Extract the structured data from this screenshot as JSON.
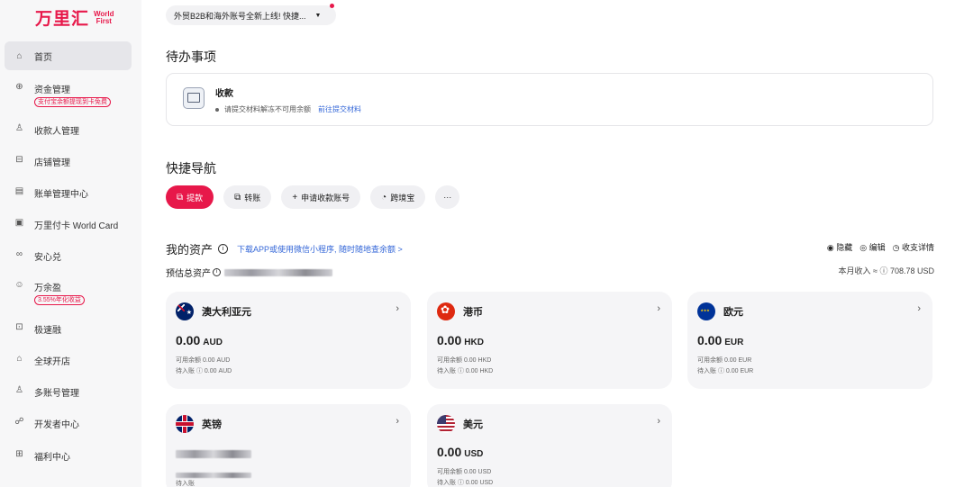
{
  "brand": {
    "logo_cn": "万里汇",
    "logo_en_line1": "World",
    "logo_en_line2": "First"
  },
  "sidebar": {
    "items": [
      {
        "label": "首页",
        "icon": "home-icon",
        "active": true
      },
      {
        "label": "资金管理",
        "icon": "fund-icon",
        "badge": "支付宝余额提现到卡免费"
      },
      {
        "label": "收款人管理",
        "icon": "payee-icon"
      },
      {
        "label": "店铺管理",
        "icon": "store-icon"
      },
      {
        "label": "账单管理中心",
        "icon": "bill-icon"
      },
      {
        "label": "万里付卡 World Card",
        "icon": "card-icon"
      },
      {
        "label": "安心兑",
        "icon": "exchange-icon"
      },
      {
        "label": "万余盈",
        "icon": "yield-icon",
        "badge": "3.55%年化收益"
      },
      {
        "label": "极速融",
        "icon": "finance-icon"
      },
      {
        "label": "全球开店",
        "icon": "global-store-icon"
      },
      {
        "label": "多账号管理",
        "icon": "multi-account-icon"
      },
      {
        "label": "开发者中心",
        "icon": "developer-icon"
      },
      {
        "label": "福利中心",
        "icon": "gift-icon"
      }
    ]
  },
  "announcement": {
    "text": "外贸B2B和海外账号全新上线! 快捷..."
  },
  "todo": {
    "section_title": "待办事项",
    "card_title": "收款",
    "desc": "请提交材料解冻不可用余额",
    "link": "前往提交材料"
  },
  "quick_nav": {
    "section_title": "快捷导航",
    "buttons": [
      {
        "label": "提款",
        "icon": "withdraw-icon",
        "primary": true
      },
      {
        "label": "转账",
        "icon": "transfer-icon"
      },
      {
        "label": "申请收款账号",
        "icon": "plus-icon"
      },
      {
        "label": "跨境宝",
        "icon": "crossborder-icon"
      },
      {
        "label": "···",
        "icon": "more-icon"
      }
    ]
  },
  "assets": {
    "title": "我的资产",
    "link": "下载APP或使用微信小程序, 随时随地查余额 >",
    "actions": {
      "hide": "隐藏",
      "edit": "编辑",
      "details": "收支详情"
    },
    "total_label": "预估总资产",
    "income": "本月收入 ≈ ⓘ 708.78 USD",
    "currencies": [
      {
        "name": "澳大利亚元",
        "flag": "flag-au",
        "amount": "0.00",
        "code": "AUD",
        "available": "可用余额 0.00 AUD",
        "pending": "待入账 ⓘ 0.00 AUD"
      },
      {
        "name": "港币",
        "flag": "flag-hk",
        "amount": "0.00",
        "code": "HKD",
        "available": "可用余额 0.00 HKD",
        "pending": "待入账 ⓘ 0.00 HKD"
      },
      {
        "name": "欧元",
        "flag": "flag-eu",
        "amount": "0.00",
        "code": "EUR",
        "available": "可用余额 0.00 EUR",
        "pending": "待入账 ⓘ 0.00 EUR"
      },
      {
        "name": "英镑",
        "flag": "flag-gb",
        "amount": "",
        "code": "",
        "available": "",
        "pending": "待入账"
      },
      {
        "name": "美元",
        "flag": "flag-us",
        "amount": "0.00",
        "code": "USD",
        "available": "可用余额 0.00 USD",
        "pending": "待入账 ⓘ 0.00 USD"
      }
    ]
  },
  "colors": {
    "brand": "#e7184a",
    "link": "#3467d8",
    "sidebar_bg": "#f7f7f8",
    "card_bg": "#f5f5f7"
  }
}
